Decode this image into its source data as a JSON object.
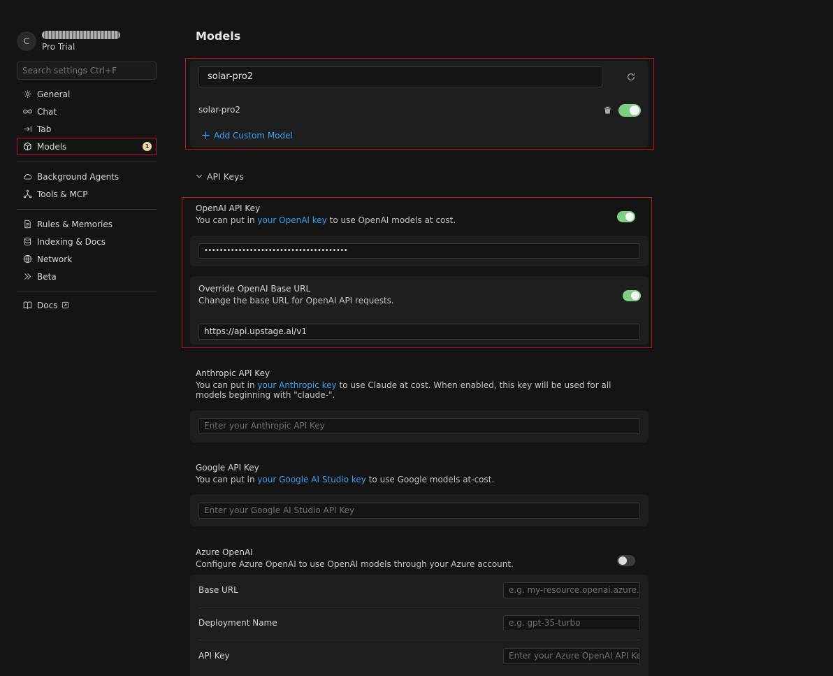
{
  "user": {
    "avatar_initial": "C",
    "plan": "Pro Trial"
  },
  "search": {
    "placeholder": "Search settings Ctrl+F"
  },
  "nav": {
    "group1": [
      {
        "label": "General",
        "icon": "gear-icon"
      },
      {
        "label": "Chat",
        "icon": "infinity-icon"
      },
      {
        "label": "Tab",
        "icon": "arrow-right-bar-icon"
      },
      {
        "label": "Models",
        "icon": "cube-icon",
        "badge": "1",
        "active": true
      }
    ],
    "group2": [
      {
        "label": "Background Agents",
        "icon": "cloud-icon"
      },
      {
        "label": "Tools & MCP",
        "icon": "nodes-icon"
      }
    ],
    "group3": [
      {
        "label": "Rules & Memories",
        "icon": "document-icon"
      },
      {
        "label": "Indexing & Docs",
        "icon": "database-icon"
      },
      {
        "label": "Network",
        "icon": "globe-icon"
      },
      {
        "label": "Beta",
        "icon": "chevrons-icon"
      }
    ],
    "group4": [
      {
        "label": "Docs",
        "icon": "book-icon"
      }
    ]
  },
  "main": {
    "title": "Models",
    "model_search_value": "solar-pro2",
    "model_item": {
      "name": "solar-pro2",
      "enabled": true
    },
    "add_custom_model": "Add Custom Model",
    "api_keys_heading": "API Keys",
    "openai": {
      "title": "OpenAI API Key",
      "desc_pre": "You can put in ",
      "desc_link": "your OpenAI key",
      "desc_post": " to use OpenAI models at cost.",
      "enabled": true,
      "key_value": "••••••••••••••••••••••••••••••••••••••",
      "override_title": "Override OpenAI Base URL",
      "override_desc": "Change the base URL for OpenAI API requests.",
      "override_enabled": true,
      "base_url_value": "https://api.upstage.ai/v1"
    },
    "anthropic": {
      "title": "Anthropic API Key",
      "desc_pre": "You can put in ",
      "desc_link": "your Anthropic key",
      "desc_post": " to use Claude at cost. When enabled, this key will be used for all models beginning with \"claude-\".",
      "placeholder": "Enter your Anthropic API Key"
    },
    "google": {
      "title": "Google API Key",
      "desc_pre": "You can put in ",
      "desc_link": "your Google AI Studio key",
      "desc_post": " to use Google models at-cost.",
      "placeholder": "Enter your Google AI Studio API Key"
    },
    "azure": {
      "title": "Azure OpenAI",
      "desc": "Configure Azure OpenAI to use OpenAI models through your Azure account.",
      "enabled": false,
      "base_url_label": "Base URL",
      "base_url_placeholder": "e.g. my-resource.openai.azure.com",
      "deployment_label": "Deployment Name",
      "deployment_placeholder": "e.g. gpt-35-turbo",
      "api_key_label": "API Key",
      "api_key_placeholder": "Enter your Azure OpenAI API Key"
    }
  },
  "colors": {
    "accent_link": "#3aa0f3",
    "toggle_on": "#7fcf83",
    "highlight_frame": "#c1121f",
    "badge": "#f2d7a5"
  }
}
